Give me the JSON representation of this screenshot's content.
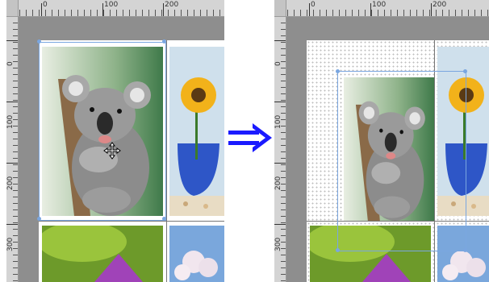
{
  "left_view": {
    "ruler_top_labels": [
      "0",
      "100",
      "200"
    ],
    "ruler_left_labels": [
      "0",
      "100",
      "200",
      "300"
    ],
    "state": "image selected at original position"
  },
  "right_view": {
    "ruler_top_labels": [
      "0",
      "100",
      "200"
    ],
    "ruler_left_labels": [
      "0",
      "100",
      "200",
      "300"
    ],
    "state": "image moved to new position"
  },
  "icons": {
    "move_cursor": "move-cursor-icon",
    "transition_arrow": "double-right-arrow-icon"
  },
  "colors": {
    "selection": "#7aa6e0",
    "arrow": "#1a1aff",
    "workspace": "#8e8e8e",
    "ruler": "#d4d4d4"
  }
}
